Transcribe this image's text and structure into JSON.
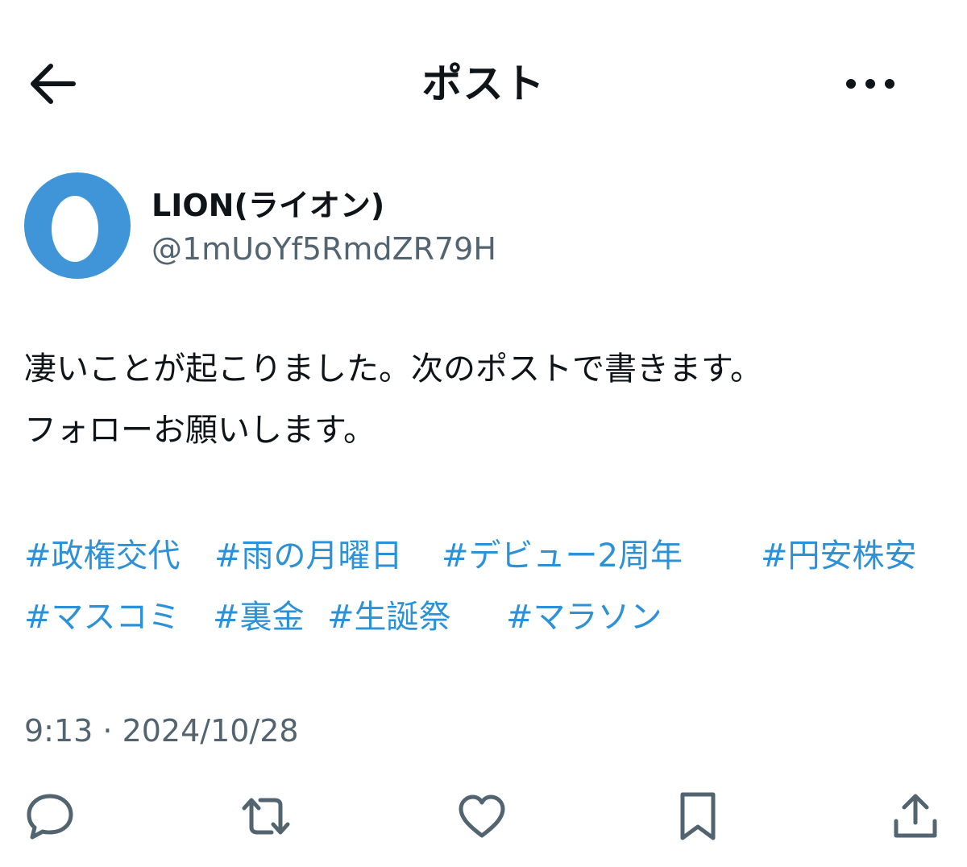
{
  "header": {
    "title": "ポスト",
    "back_icon": "arrow-left-icon",
    "more_icon": "more-horizontal-icon"
  },
  "author": {
    "display_name": "LION(ライオン)",
    "handle": "@1mUoYf5RmdZR79H",
    "avatar_color": "#3f95d8"
  },
  "post": {
    "lines": [
      "凄いことが起こりました。次のポストで書きます。",
      "フォローお願いします。"
    ],
    "hashtag_rows": [
      [
        "#政権交代",
        "#雨の月曜日",
        "#デビュー2周年",
        "#円安株安"
      ],
      [
        "#マスコミ",
        "#裏金",
        "#生誕祭",
        "#マラソン"
      ]
    ],
    "timestamp": "9:13 · 2024/10/28"
  },
  "actions": [
    {
      "name": "reply",
      "icon": "reply-icon"
    },
    {
      "name": "repost",
      "icon": "repost-icon"
    },
    {
      "name": "like",
      "icon": "heart-icon"
    },
    {
      "name": "bookmark",
      "icon": "bookmark-icon"
    },
    {
      "name": "share",
      "icon": "share-icon"
    }
  ],
  "colors": {
    "text": "#0f1419",
    "secondary": "#536471",
    "link": "#2c91d6"
  }
}
